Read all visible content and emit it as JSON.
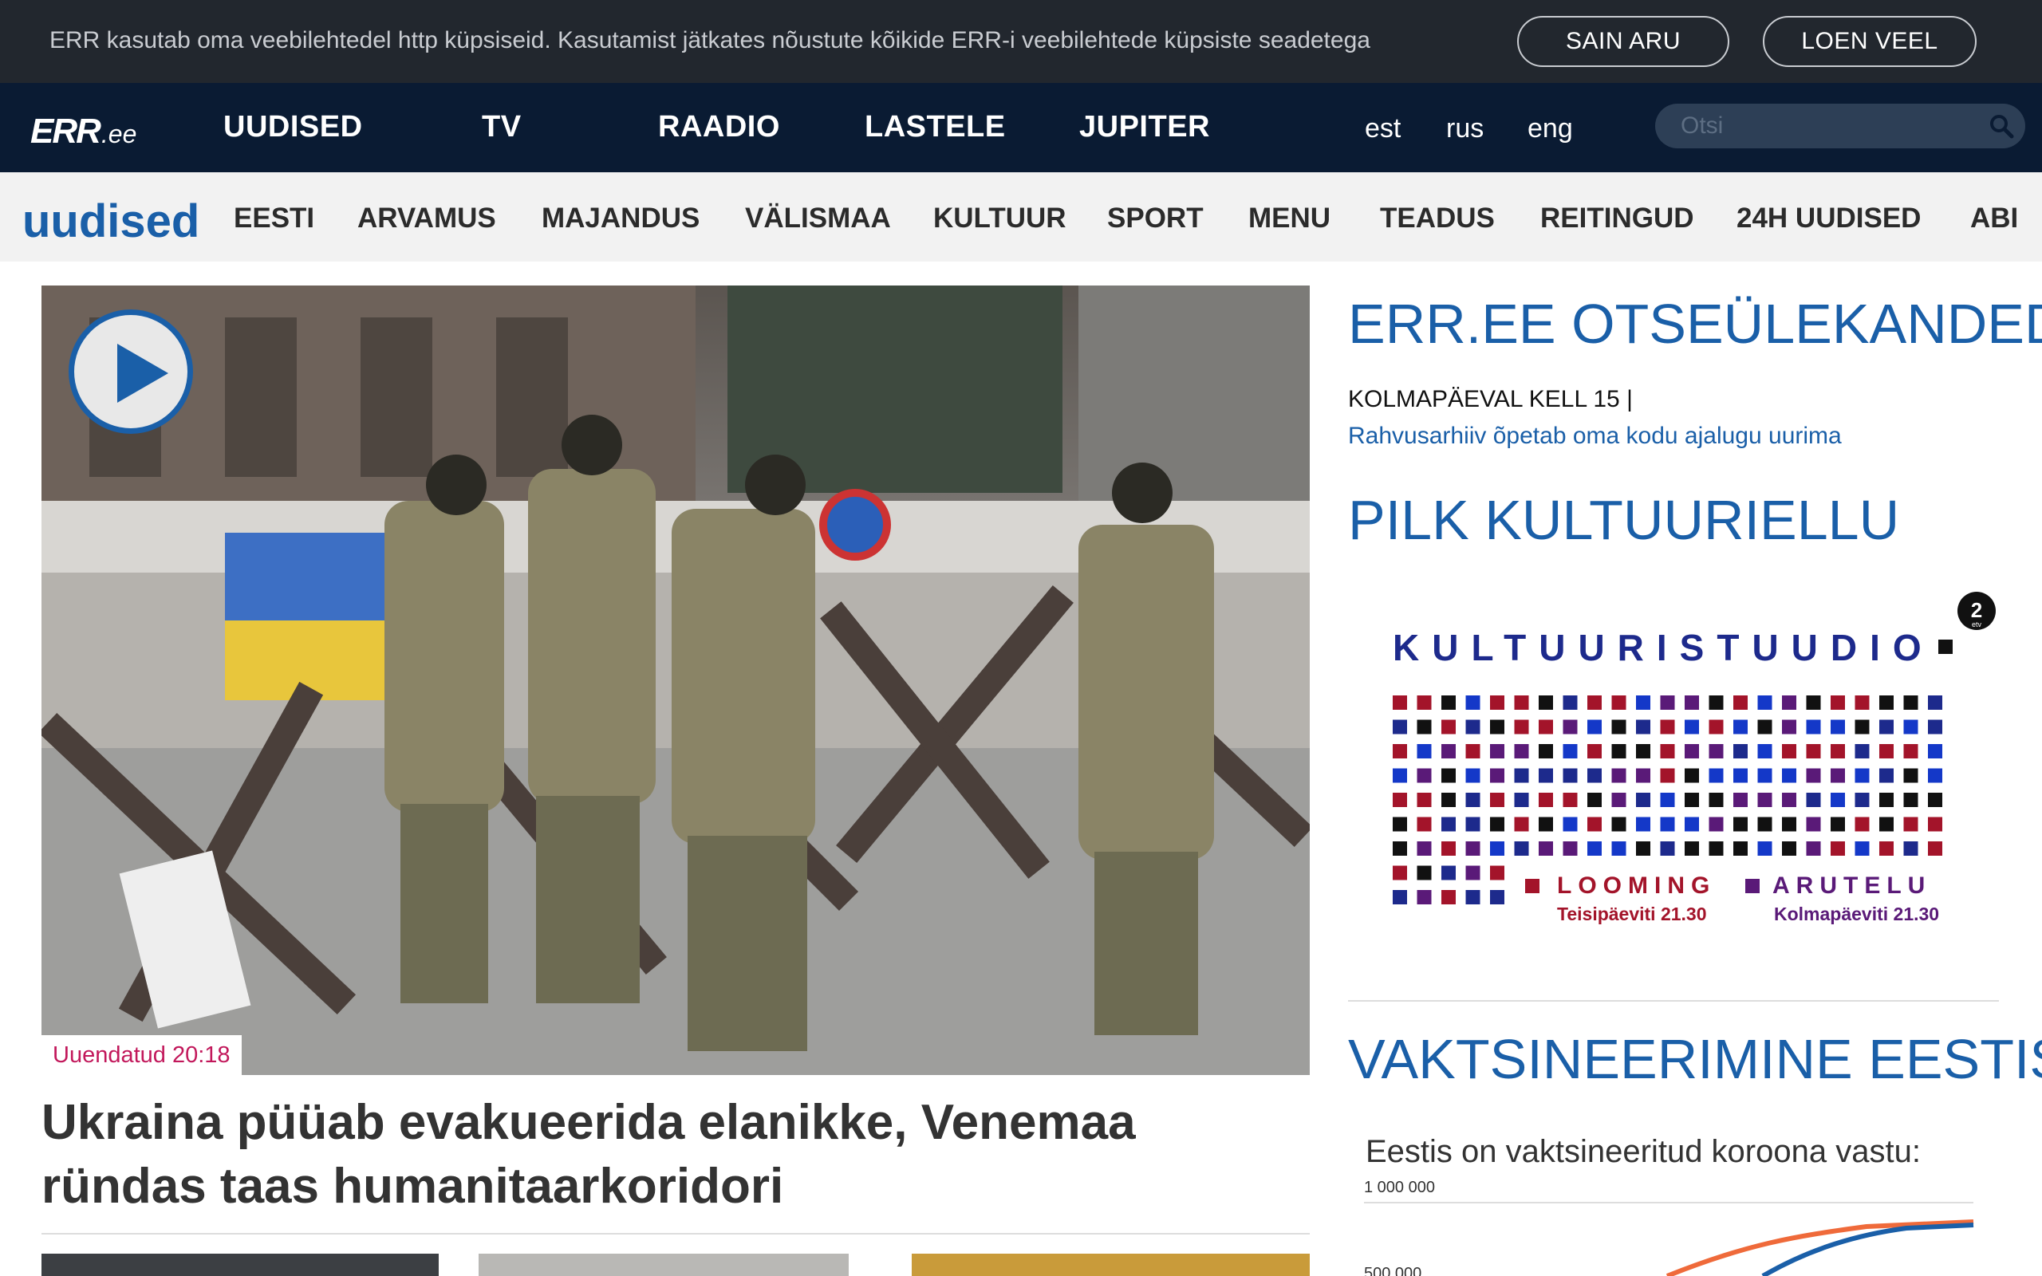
{
  "cookie_bar": {
    "text": "ERR kasutab oma veebilehtedel http küpsiseid. Kasutamist jätkates nõustute kõikide ERR-i veebilehtede küpsiste seadetega",
    "agree_label": "SAIN ARU",
    "more_label": "LOEN VEEL"
  },
  "main_nav": {
    "logo_main": "ERR",
    "logo_suffix": ".ee",
    "items": [
      "UUDISED",
      "TV",
      "RAADIO",
      "LASTELE",
      "JUPITER"
    ],
    "languages": [
      "est",
      "rus",
      "eng"
    ],
    "search_placeholder": "Otsi"
  },
  "section_nav": {
    "logo": "uudised",
    "items": [
      "EESTI",
      "ARVAMUS",
      "MAJANDUS",
      "VÄLISMAA",
      "KULTUUR",
      "SPORT",
      "MENU",
      "TEADUS",
      "REITINGUD",
      "24H UUDISED",
      "ABI"
    ]
  },
  "hero": {
    "updated": "Uuendatud 20:18",
    "title": "Ukraina püüab evakueerida elanikke, Venemaa ründas taas humanitaarkoridori"
  },
  "sidebar": {
    "live_heading": "ERR.EE OTSEÜLEKANDED",
    "live_time": "KOLMAPÄEVAL KELL 15 |",
    "live_link": "Rahvusarhiiv õpetab oma kodu ajalugu uurima",
    "culture_heading": "PILK KULTUURIELLU",
    "banner": {
      "title": "KULTUURISTUUDIO",
      "channel_badge": "2",
      "channel_sub": "etv",
      "left_label": "LOOMING",
      "left_time": "Teisipäeviti 21.30",
      "right_label": "ARUTELU",
      "right_time": "Kolmapäeviti 21.30"
    },
    "vax_heading": "VAKTSINEERIMINE EESTIS",
    "vax_chart_title": "Eestis on vaktsineeritud koroona vastu:",
    "vax_tick_top": "1 000 000",
    "vax_tick_mid": "500 000"
  },
  "colors": {
    "cookie_bg": "#22272e",
    "nav_bg": "#0a1b33",
    "brand_blue": "#1a5fa8",
    "badge_red": "#c2185b"
  }
}
